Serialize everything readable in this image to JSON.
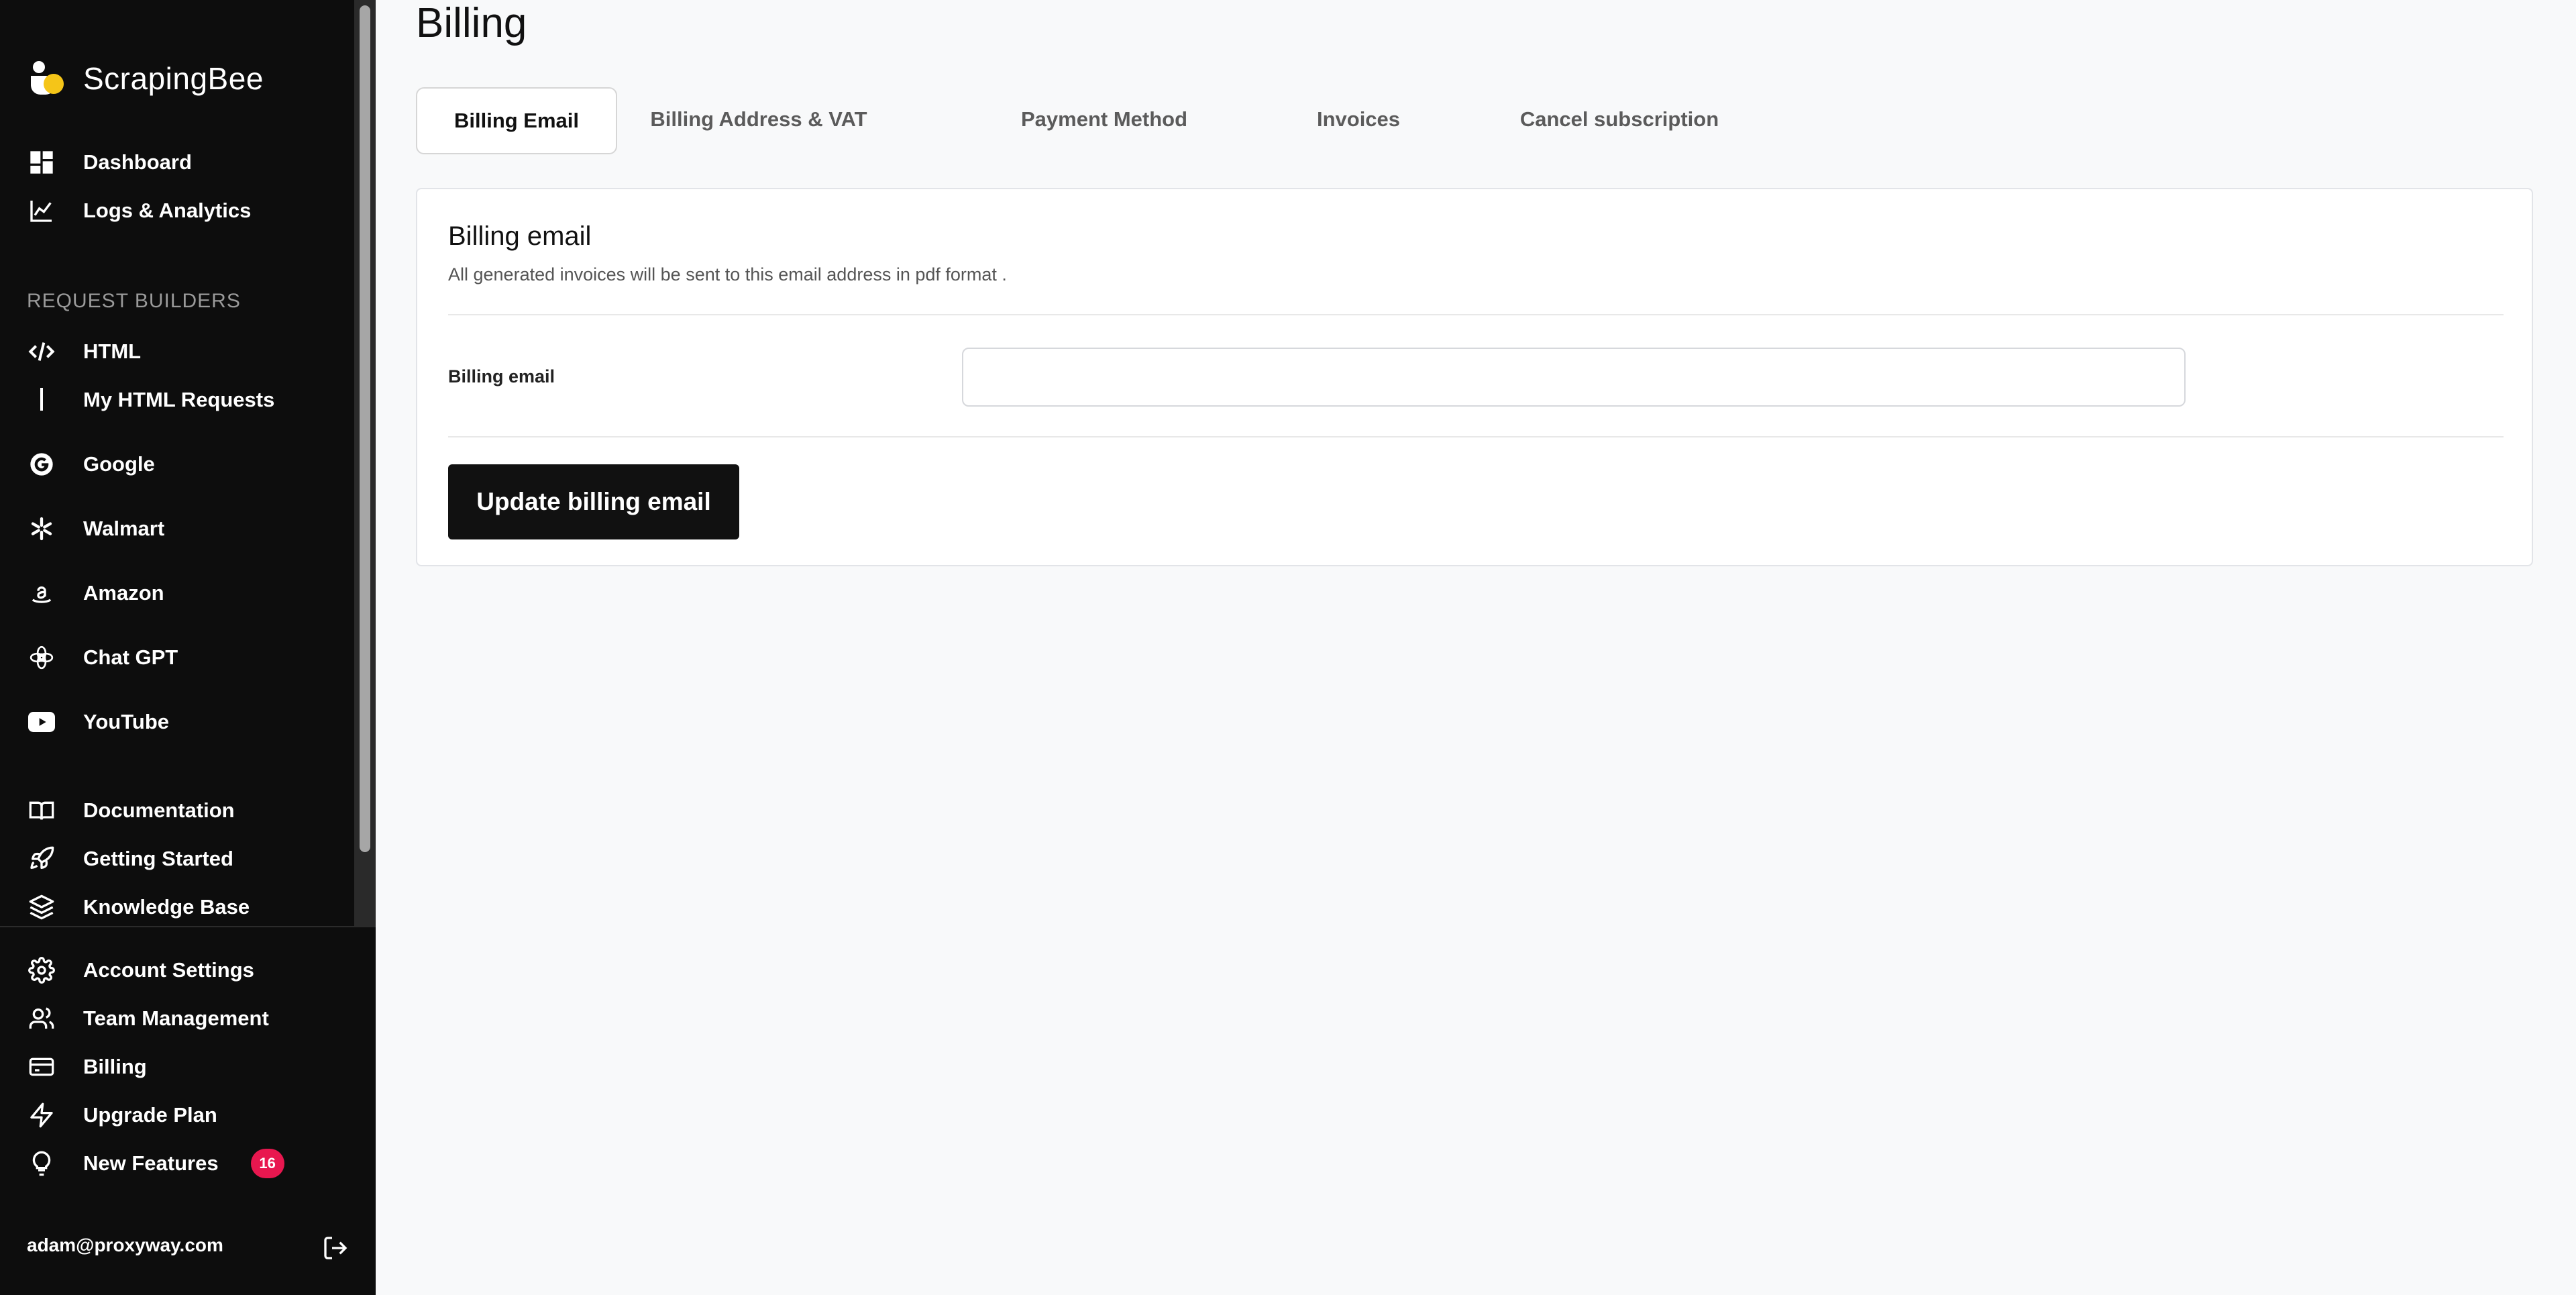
{
  "brand": {
    "name": "ScrapingBee",
    "logo": "bee-logo-icon",
    "accent": "#f5c518"
  },
  "sidebar": {
    "main_items": [
      {
        "label": "Dashboard",
        "icon": "dashboard-icon"
      },
      {
        "label": "Logs & Analytics",
        "icon": "chart-line-icon"
      }
    ],
    "section_title": "REQUEST BUILDERS",
    "builders": [
      {
        "label": "HTML",
        "icon": "code-icon"
      },
      {
        "label": "My HTML Requests",
        "icon": "vertical-bar"
      },
      {
        "label": "Google",
        "icon": "google-icon"
      },
      {
        "label": "Walmart",
        "icon": "walmart-spark-icon"
      },
      {
        "label": "Amazon",
        "icon": "amazon-icon"
      },
      {
        "label": "Chat GPT",
        "icon": "openai-icon"
      },
      {
        "label": "YouTube",
        "icon": "youtube-icon"
      }
    ],
    "resources": [
      {
        "label": "Documentation",
        "icon": "book-icon"
      },
      {
        "label": "Getting Started",
        "icon": "rocket-icon"
      },
      {
        "label": "Knowledge Base",
        "icon": "layers-icon"
      }
    ],
    "account": [
      {
        "label": "Account Settings",
        "icon": "gear-icon"
      },
      {
        "label": "Team Management",
        "icon": "users-icon"
      },
      {
        "label": "Billing",
        "icon": "credit-card-icon"
      },
      {
        "label": "Upgrade Plan",
        "icon": "lightning-icon"
      },
      {
        "label": "New Features",
        "icon": "lightbulb-icon",
        "badge": "16"
      }
    ],
    "user_email": "adam@proxyway.com",
    "logout_icon": "logout-icon",
    "badge_color": "#e8174f"
  },
  "page": {
    "title": "Billing",
    "tabs": [
      {
        "label": "Billing Email",
        "active": true
      },
      {
        "label": "Billing Address & VAT",
        "active": false
      },
      {
        "label": "Payment Method",
        "active": false
      },
      {
        "label": "Invoices",
        "active": false
      },
      {
        "label": "Cancel subscription",
        "active": false
      }
    ],
    "card": {
      "title": "Billing email",
      "description": "All generated invoices will be sent to this email address in pdf format .",
      "field_label": "Billing email",
      "field_value": "",
      "field_placeholder": "",
      "submit_label": "Update billing email"
    }
  }
}
